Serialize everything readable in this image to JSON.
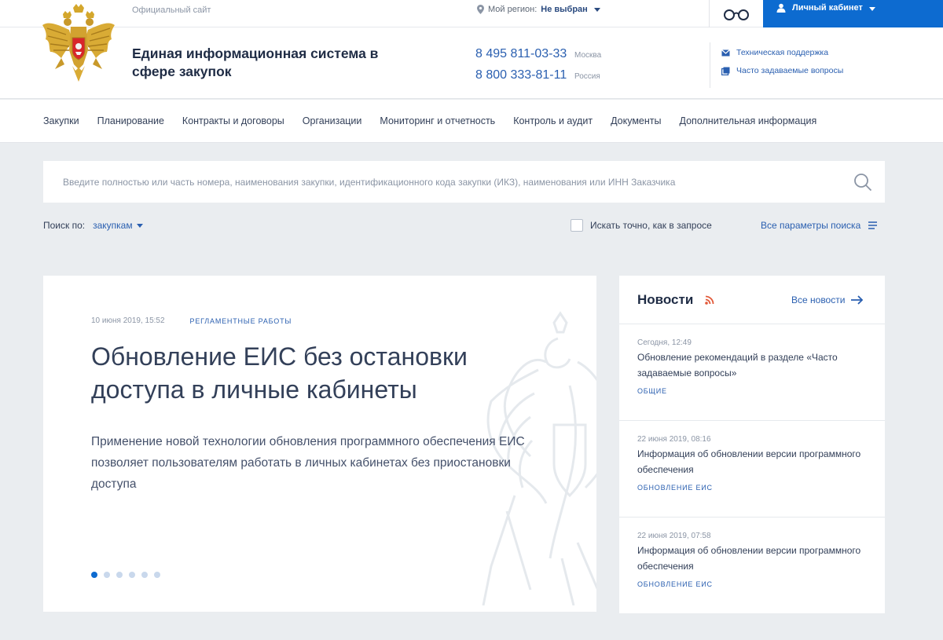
{
  "header": {
    "official_label": "Официальный сайт",
    "region_label": "Мой регион:",
    "region_value": "Не выбран",
    "cabinet_label": "Личный кабинет",
    "site_title": "Единая информационная система в сфере закупок",
    "phones": [
      {
        "number": "8 495 811-03-33",
        "city": "Москва"
      },
      {
        "number": "8 800 333-81-11",
        "city": "Россия"
      }
    ],
    "support_links": [
      {
        "label": "Техническая поддержка",
        "icon": "mail-icon"
      },
      {
        "label": "Часто задаваемые вопросы",
        "icon": "faq-icon"
      }
    ]
  },
  "nav": {
    "items": [
      "Закупки",
      "Планирование",
      "Контракты и договоры",
      "Организации",
      "Мониторинг и отчетность",
      "Контроль и аудит",
      "Документы",
      "Дополнительная информация"
    ]
  },
  "search": {
    "placeholder": "Введите полностью или часть номера, наименования закупки, идентификационного кода закупки (ИКЗ), наименования или ИНН Заказчика",
    "by_label": "Поиск по:",
    "by_value": "закупкам",
    "exact_label": "Искать точно, как в запросе",
    "all_params_label": "Все параметры поиска"
  },
  "slide": {
    "date": "10 июня 2019, 15:52",
    "category": "РЕГЛАМЕНТНЫЕ РАБОТЫ",
    "title": "Обновление ЕИС без остановки доступа в личные кабинеты",
    "text": "Применение новой технологии обновления программного обеспечения ЕИС позволяет пользователям работать в личных кабинетах без приостановки доступа",
    "dots_total": 6,
    "dots_active": 0
  },
  "news": {
    "title": "Новости",
    "all_label": "Все новости",
    "items": [
      {
        "date": "Сегодня, 12:49",
        "text": "Обновление рекомендаций в разделе «Часто задаваемые вопросы»",
        "category": "ОБЩИЕ"
      },
      {
        "date": "22 июня 2019, 08:16",
        "text": "Информация об обновлении версии программного обеспечения",
        "category": "ОБНОВЛЕНИЕ ЕИС"
      },
      {
        "date": "22 июня 2019, 07:58",
        "text": "Информация об обновлении версии программного обеспечения",
        "category": "ОБНОВЛЕНИЕ ЕИС"
      }
    ]
  },
  "colors": {
    "accent": "#0d6bd0",
    "link": "#2a5fb0",
    "text": "#334059",
    "background": "#eaedf0"
  }
}
